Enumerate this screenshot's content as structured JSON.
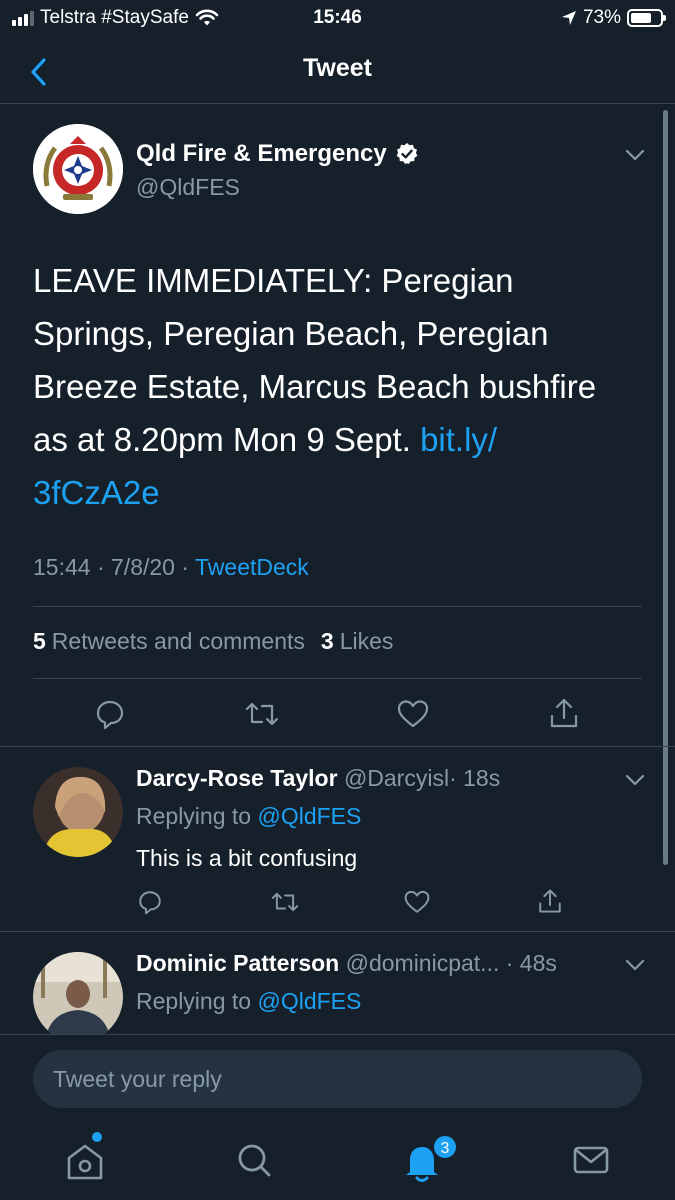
{
  "status_bar": {
    "carrier": "Telstra #StaySafe",
    "time": "15:46",
    "battery": "73%",
    "battery_level": 0.73
  },
  "nav": {
    "title": "Tweet"
  },
  "tweet": {
    "author_name": "Qld Fire & Emergency",
    "author_handle": "@QldFES",
    "text_plain": "LEAVE IMMEDIATELY: Peregian Springs, Peregian Beach, Peregian Breeze Estate, Marcus Beach bushfire as at 8.20pm Mon 9 Sept. ",
    "text_link": "bit.ly/\n3fCzA2e",
    "time": "15:44",
    "date": "7/8/20",
    "sep": "·",
    "source": "TweetDeck",
    "retweets_count": "5",
    "retweets_label": "Retweets and comments",
    "likes_count": "3",
    "likes_label": "Likes"
  },
  "replies": [
    {
      "name": "Darcy-Rose Taylor",
      "handle": "@Darcyisl",
      "time": "· 18s",
      "replying_label": "Replying to",
      "replying_to": "@QldFES",
      "text": "This is a bit confusing"
    },
    {
      "name": "Dominic Patterson",
      "handle": "@dominicpat...",
      "time": "· 48s",
      "replying_label": "Replying to",
      "replying_to": "@QldFES",
      "text": ""
    }
  ],
  "compose": {
    "placeholder": "Tweet your reply"
  },
  "tab_bar": {
    "notifications_badge": "3"
  },
  "colors": {
    "background": "#15202b",
    "accent": "#1da1f2",
    "secondary_text": "#8899a6",
    "divider": "#38444d"
  }
}
